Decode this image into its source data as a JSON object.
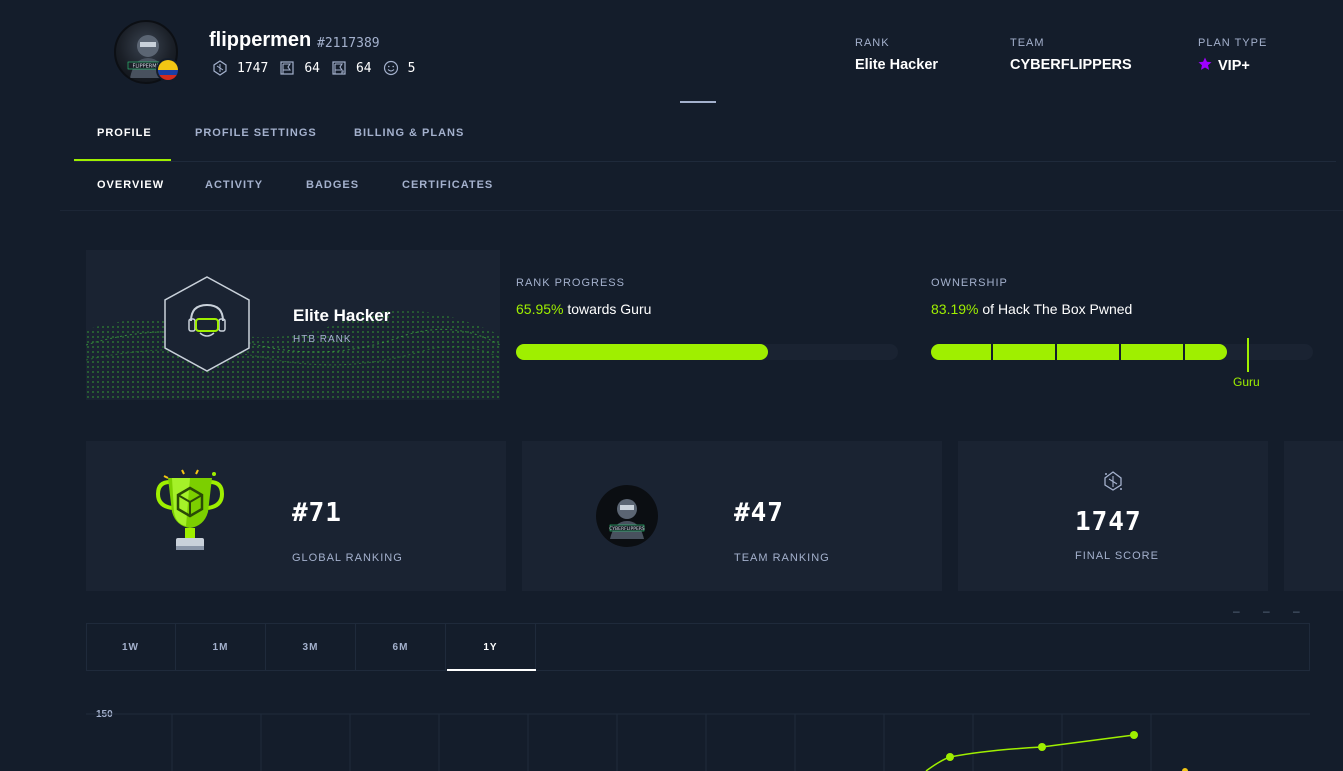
{
  "user": {
    "name": "flippermen",
    "id": "#2117389",
    "points": "1747",
    "user_owns": "64",
    "system_owns": "64",
    "respect": "5",
    "country_colors": [
      "#f3c614",
      "#1b3fa6",
      "#d52b1e"
    ]
  },
  "meta": {
    "rank_label": "RANK",
    "rank_value": "Elite Hacker",
    "team_label": "TEAM",
    "team_value": "CYBERFLIPPERS",
    "plan_label": "PLAN TYPE",
    "plan_value": "VIP+",
    "plan_color": "#9f00ff"
  },
  "tabs": [
    "PROFILE",
    "PROFILE SETTINGS",
    "BILLING & PLANS"
  ],
  "subtabs": [
    "OVERVIEW",
    "ACTIVITY",
    "BADGES",
    "CERTIFICATES"
  ],
  "rank_card": {
    "title": "Elite Hacker",
    "subtitle": "HTB RANK"
  },
  "rank_progress": {
    "label": "RANK PROGRESS",
    "percent_text": "65.95%",
    "suffix": "towards Guru",
    "value": 0.6595
  },
  "ownership": {
    "label": "OWNERSHIP",
    "percent_text": "83.19%",
    "suffix": "of Hack The Box Pwned",
    "value": 0.8319,
    "marker_label": "Guru"
  },
  "cards": {
    "global": {
      "value": "#71",
      "label": "GLOBAL RANKING"
    },
    "team": {
      "value": "#47",
      "label": "TEAM RANKING"
    },
    "score": {
      "value": "1747",
      "label": "FINAL SCORE"
    }
  },
  "range_tabs": [
    "1W",
    "1M",
    "3M",
    "6M",
    "1Y"
  ],
  "active_range": "1Y",
  "chart": {
    "y_top_label": "150"
  },
  "accent": "#9fef00"
}
